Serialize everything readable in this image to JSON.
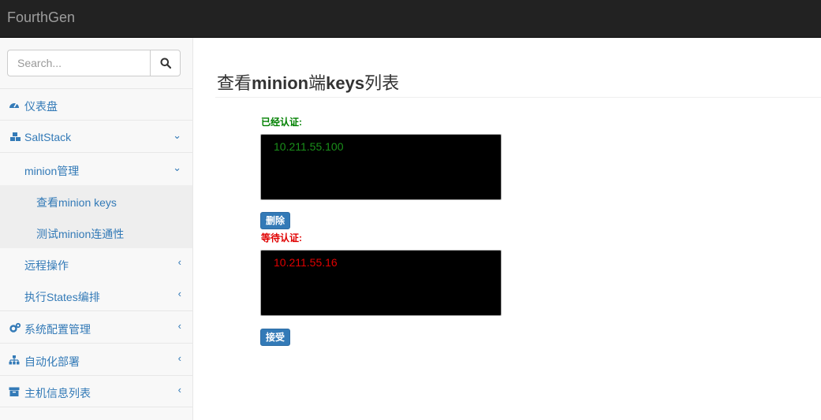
{
  "brand": "FourthGen",
  "search": {
    "placeholder": "Search..."
  },
  "sidebar": {
    "items": [
      {
        "label": "仪表盘"
      },
      {
        "label": "SaltStack",
        "chevron": "⌄"
      },
      {
        "label": "minion管理",
        "chevron": "⌄"
      },
      {
        "label": "查看minion keys"
      },
      {
        "label": "测试minion连通性"
      },
      {
        "label": "远程操作",
        "chevron": "‹"
      },
      {
        "label": "执行States编排",
        "chevron": "‹"
      },
      {
        "label": "系统配置管理",
        "chevron": "‹"
      },
      {
        "label": "自动化部署",
        "chevron": "‹"
      },
      {
        "label": "主机信息列表",
        "chevron": "‹"
      }
    ]
  },
  "main": {
    "title_prefix": "查看",
    "title_mid1": "minion",
    "title_mid2": "端",
    "title_mid3": "keys",
    "title_suffix": "列表",
    "accepted_label": "已经认证:",
    "accepted_keys": "10.211.55.100",
    "delete_button": "删除",
    "pending_label": "等待认证:",
    "pending_keys": "10.211.55.16",
    "accept_button": "接受"
  },
  "colors": {
    "topbar": "#222222",
    "link": "#337ab7",
    "accepted": "#008000",
    "pending": "#e00000"
  }
}
